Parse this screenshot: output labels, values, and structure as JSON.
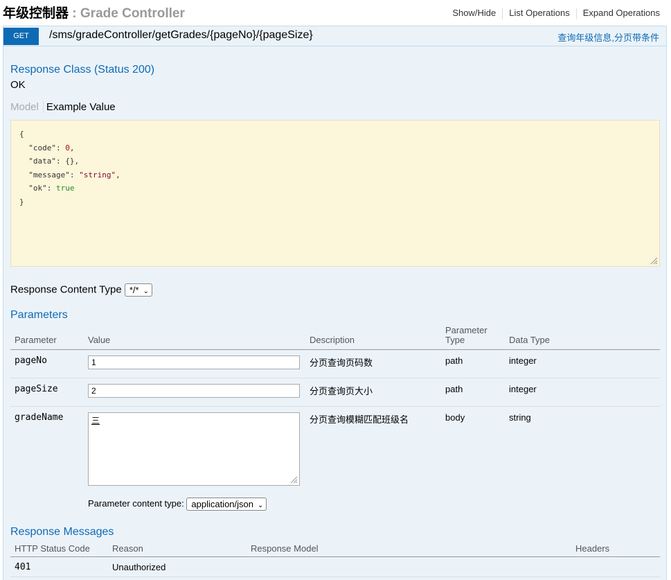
{
  "header": {
    "title_zh": "年级控制器",
    "separator": " : ",
    "title_en": "Grade Controller",
    "links": [
      "Show/Hide",
      "List Operations",
      "Expand Operations"
    ]
  },
  "operation": {
    "method": "GET",
    "path": "/sms/gradeController/getGrades/{pageNo}/{pageSize}",
    "summary": "查询年级信息,分页带条件"
  },
  "response_class": {
    "heading": "Response Class (Status 200)",
    "status_text": "OK",
    "tabs": [
      "Model",
      "Example Value"
    ],
    "example": {
      "code": "0",
      "data": "{}",
      "message": "\"string\"",
      "ok": "true"
    }
  },
  "response_content_type": {
    "label": "Response Content Type",
    "value": "*/*"
  },
  "parameters": {
    "heading": "Parameters",
    "columns": [
      "Parameter",
      "Value",
      "Description",
      "Parameter Type",
      "Data Type"
    ],
    "rows": [
      {
        "name": "pageNo",
        "value": "1",
        "description": "分页查询页码数",
        "param_type": "path",
        "data_type": "integer"
      },
      {
        "name": "pageSize",
        "value": "2",
        "description": "分页查询页大小",
        "param_type": "path",
        "data_type": "integer"
      },
      {
        "name": "gradeName",
        "value": "三",
        "description": "分页查询模糊匹配班级名",
        "param_type": "body",
        "data_type": "string"
      }
    ],
    "content_type_label": "Parameter content type:",
    "content_type_value": "application/json"
  },
  "response_messages": {
    "heading": "Response Messages",
    "columns": [
      "HTTP Status Code",
      "Reason",
      "Response Model",
      "Headers"
    ],
    "rows": [
      {
        "code": "401",
        "reason": "Unauthorized",
        "model": "",
        "headers": ""
      }
    ]
  }
}
